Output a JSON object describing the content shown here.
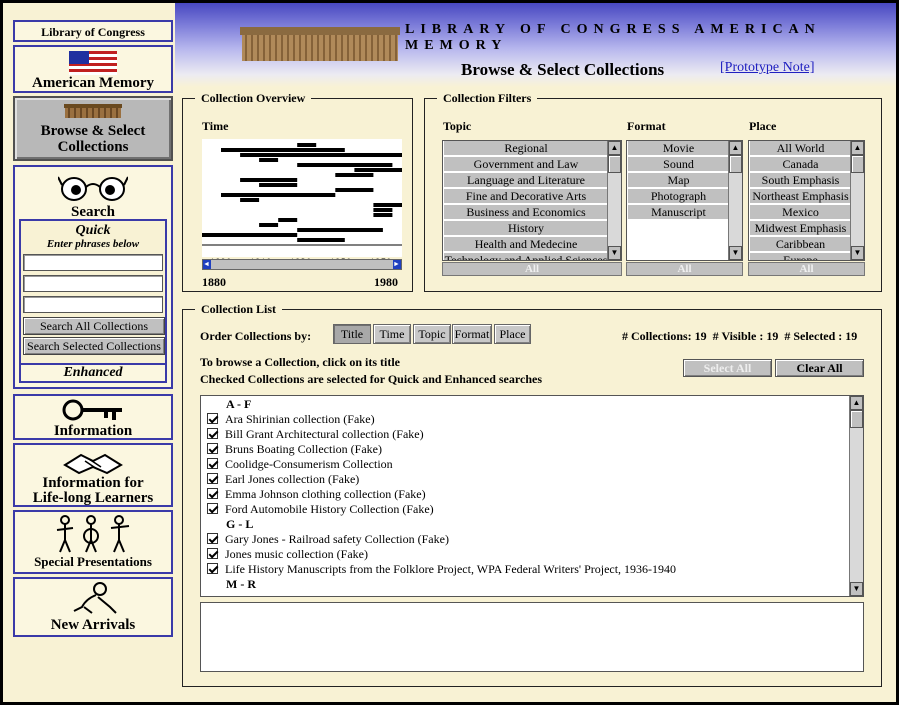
{
  "header": {
    "title": "LIBRARY OF CONGRESS AMERICAN MEMORY",
    "subtitle": "Browse & Select Collections",
    "prototype_note": "[Prototype Note]"
  },
  "sidebar": {
    "loc": "Library of Congress",
    "american_memory": "American Memory",
    "browse_line1": "Browse & Select",
    "browse_line2": "Collections",
    "search": "Search",
    "quick": "Quick",
    "quick_hint": "Enter phrases below",
    "search_all": "Search All Collections",
    "search_selected": "Search Selected Collections",
    "enhanced": "Enhanced",
    "information": "Information",
    "lifelong_line1": "Information for",
    "lifelong_line2": "Life-long Learners",
    "special": "Special Presentations",
    "new_arrivals": "New Arrivals"
  },
  "overview": {
    "legend": "Collection Overview",
    "time_label": "Time",
    "axis_ticks": [
      "1890",
      "1910",
      "1930",
      "1950",
      "1970"
    ],
    "range_start": "1880",
    "range_end": "1980",
    "bars": [
      [
        1930,
        1940
      ],
      [
        1890,
        1955
      ],
      [
        1900,
        1985
      ],
      [
        1910,
        1920
      ],
      [
        1930,
        1980
      ],
      [
        1960,
        1990
      ],
      [
        1950,
        1970
      ],
      [
        1900,
        1930
      ],
      [
        1910,
        1930
      ],
      [
        1950,
        1970
      ],
      [
        1890,
        1950
      ],
      [
        1900,
        1910
      ],
      [
        1970,
        1985
      ],
      [
        1970,
        1980
      ],
      [
        1970,
        1980
      ],
      [
        1920,
        1930
      ],
      [
        1910,
        1920
      ],
      [
        1930,
        1975
      ],
      [
        1880,
        1930
      ],
      [
        1930,
        1955
      ]
    ]
  },
  "filters": {
    "legend": "Collection Filters",
    "topic_label": "Topic",
    "format_label": "Format",
    "place_label": "Place",
    "topics": [
      "Regional",
      "Government and Law",
      "Language and Literature",
      "Fine and Decorative Arts",
      "Business and Economics",
      "History",
      "Health and Medecine",
      "Technology and Applied Sciences"
    ],
    "formats": [
      "Movie",
      "Sound",
      "Map",
      "Photograph",
      "Manuscript"
    ],
    "places": [
      "All World",
      "Canada",
      "South Emphasis",
      "Northeast Emphasis",
      "Mexico",
      "Midwest Emphasis",
      "Caribbean",
      "Europe"
    ],
    "all_label": "All"
  },
  "collection_list": {
    "legend": "Collection List",
    "order_by": "Order Collections by:",
    "order_buttons": [
      "Title",
      "Time",
      "Topic",
      "Format",
      "Place"
    ],
    "counts": "# Collections: 19  # Visible : 19  # Selected : 19",
    "instr1": "To browse a Collection, click on its title",
    "instr2": "Checked Collections are selected for Quick and Enhanced searches",
    "select_all": "Select All",
    "clear_all": "Clear All",
    "groups": [
      {
        "head": "A - F",
        "items": [
          "Ara Shirinian collection (Fake)",
          "Bill Grant Architectural collection (Fake)",
          "Bruns Boating Collection (Fake)",
          "Coolidge-Consumerism Collection",
          "Earl Jones collection (Fake)",
          "Emma Johnson clothing collection (Fake)",
          "Ford Automobile History Collection (Fake)"
        ]
      },
      {
        "head": "G - L",
        "items": [
          "Gary Jones - Railroad safety Collection (Fake)",
          "Jones music collection (Fake)",
          "Life History Manuscripts from the Folklore Project, WPA Federal Writers' Project, 1936-1940"
        ]
      },
      {
        "head": "M - R",
        "items": []
      }
    ]
  },
  "colors": {
    "nav_border": "#3a3aa8",
    "background": "#f8f2d4",
    "band_top": "#4848c0"
  }
}
